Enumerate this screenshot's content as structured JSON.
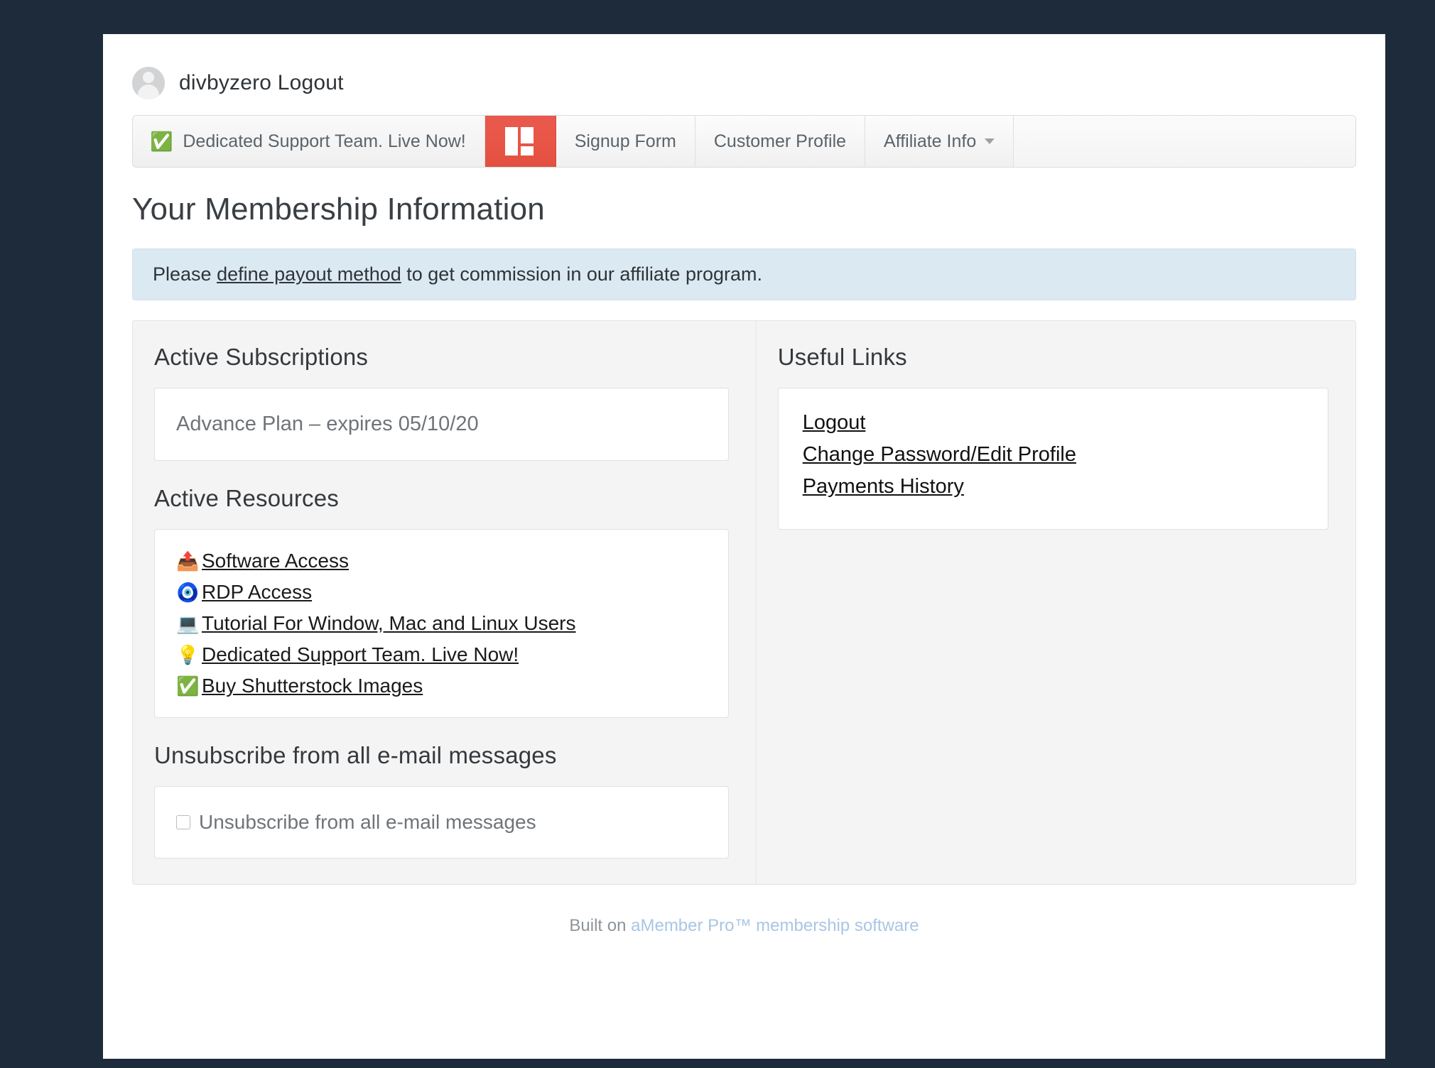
{
  "user_bar": {
    "name_logout": "divbyzero Logout",
    "avatar_icon": "avatar-placeholder-icon"
  },
  "nav": {
    "items": [
      {
        "label": "Dedicated Support Team. Live Now!",
        "icon": "white-check-mark-icon",
        "emoji": "✅",
        "type": "link"
      },
      {
        "label": "",
        "icon": "amember-grid-logo-icon",
        "type": "logo"
      },
      {
        "label": "Signup Form",
        "type": "link"
      },
      {
        "label": "Customer Profile",
        "type": "link"
      },
      {
        "label": "Affiliate Info",
        "type": "dropdown",
        "caret": true
      }
    ]
  },
  "page": {
    "title": "Your Membership Information"
  },
  "alert": {
    "prefix": "Please ",
    "link_text": "define payout method",
    "suffix": " to get commission in our affiliate program.",
    "background_color": "#dbe9f2"
  },
  "left_column": {
    "subscriptions": {
      "heading": "Active Subscriptions",
      "items": [
        {
          "text": "Advance Plan – expires 05/10/20"
        }
      ]
    },
    "resources": {
      "heading": "Active Resources",
      "items": [
        {
          "label": "Software Access",
          "icon": "outbox-tray-icon",
          "emoji": "📤"
        },
        {
          "label": "RDP Access",
          "icon": "nazar-amulet-icon",
          "emoji": "🧿"
        },
        {
          "label": "Tutorial For Window, Mac and Linux Users",
          "icon": "laptop-icon",
          "emoji": "💻"
        },
        {
          "label": "Dedicated Support Team. Live Now!",
          "icon": "light-bulb-icon",
          "emoji": "💡"
        },
        {
          "label": "Buy Shutterstock Images",
          "icon": "white-check-mark-icon",
          "emoji": "✅"
        }
      ]
    },
    "unsubscribe": {
      "heading": "Unsubscribe from all e-mail messages",
      "checkbox_label": "Unsubscribe from all e-mail messages",
      "checked": false
    }
  },
  "right_column": {
    "useful_links": {
      "heading": "Useful Links",
      "items": [
        {
          "label": "Logout"
        },
        {
          "label": "Change Password/Edit Profile"
        },
        {
          "label": "Payments History"
        }
      ]
    }
  },
  "footer": {
    "prefix": "Built on ",
    "link_text": "aMember Pro™ membership software",
    "link_color": "#a9c6e4"
  },
  "theme": {
    "page_background": "#1e2b3a",
    "card_background": "#ffffff",
    "panel_background": "#f4f4f4",
    "accent_red": "#e85546"
  }
}
